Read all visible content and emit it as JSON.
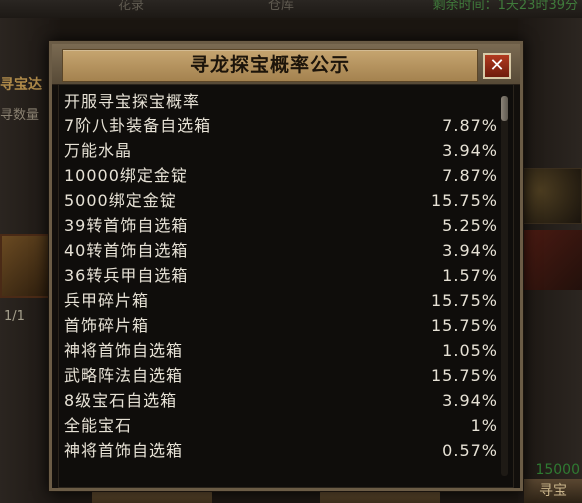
{
  "background": {
    "tabs": [
      "花录",
      "仓库"
    ],
    "timer": "剩余时间：1天23时39分",
    "left_title": "寻宝达",
    "left_label": "寻数量",
    "left_count": "1/1",
    "right_amount": "15000",
    "bottom_right": "寻宝"
  },
  "dialog": {
    "title": "寻龙探宝概率公示",
    "close_label": "✕",
    "header": "开服寻宝探宝概率",
    "rows": [
      {
        "name": "7阶八卦装备自选箱",
        "pct": "7.87%"
      },
      {
        "name": "万能水晶",
        "pct": "3.94%"
      },
      {
        "name": "10000绑定金锭",
        "pct": "7.87%"
      },
      {
        "name": "5000绑定金锭",
        "pct": "15.75%"
      },
      {
        "name": "39转首饰自选箱",
        "pct": "5.25%"
      },
      {
        "name": "40转首饰自选箱",
        "pct": "3.94%"
      },
      {
        "name": "36转兵甲自选箱",
        "pct": "1.57%"
      },
      {
        "name": "兵甲碎片箱",
        "pct": "15.75%"
      },
      {
        "name": "首饰碎片箱",
        "pct": "15.75%"
      },
      {
        "name": "神将首饰自选箱",
        "pct": "1.05%"
      },
      {
        "name": "武略阵法自选箱",
        "pct": "15.75%"
      },
      {
        "name": "8级宝石自选箱",
        "pct": "3.94%"
      },
      {
        "name": "全能宝石",
        "pct": "1%"
      },
      {
        "name": "神将首饰自选箱",
        "pct": "0.57%"
      }
    ]
  },
  "colors": {
    "text": "#e7e2d6",
    "title_plate": "#b9955f",
    "close_red": "#a3311a",
    "frame": "#6b5c46"
  }
}
